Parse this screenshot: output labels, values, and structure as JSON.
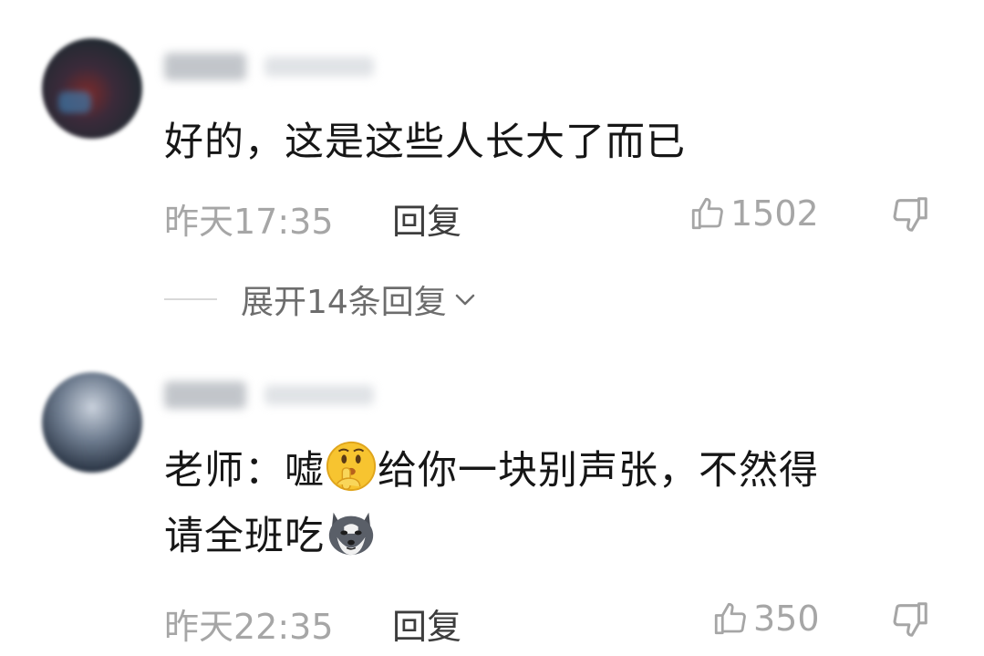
{
  "comments": [
    {
      "text": "好的，这是这些人长大了而已",
      "time": "昨天17:35",
      "reply_label": "回复",
      "likes": "1502",
      "expand_label": "展开14条回复"
    },
    {
      "text_part1": "老师：嘘",
      "text_part2": "给你一块别声张，不然得",
      "text_part3": "请全班吃",
      "time": "昨天22:35",
      "reply_label": "回复",
      "likes": "350"
    }
  ],
  "icons": {
    "like": "thumbs-up-icon",
    "dislike": "thumbs-down-icon",
    "expand": "chevron-down-icon",
    "emoji_1": "shushing-face-emoji",
    "emoji_2": "husky-dog-emoji"
  },
  "colors": {
    "text": "#161616",
    "meta": "#a6a6a6",
    "reply": "#3d3d3d"
  }
}
